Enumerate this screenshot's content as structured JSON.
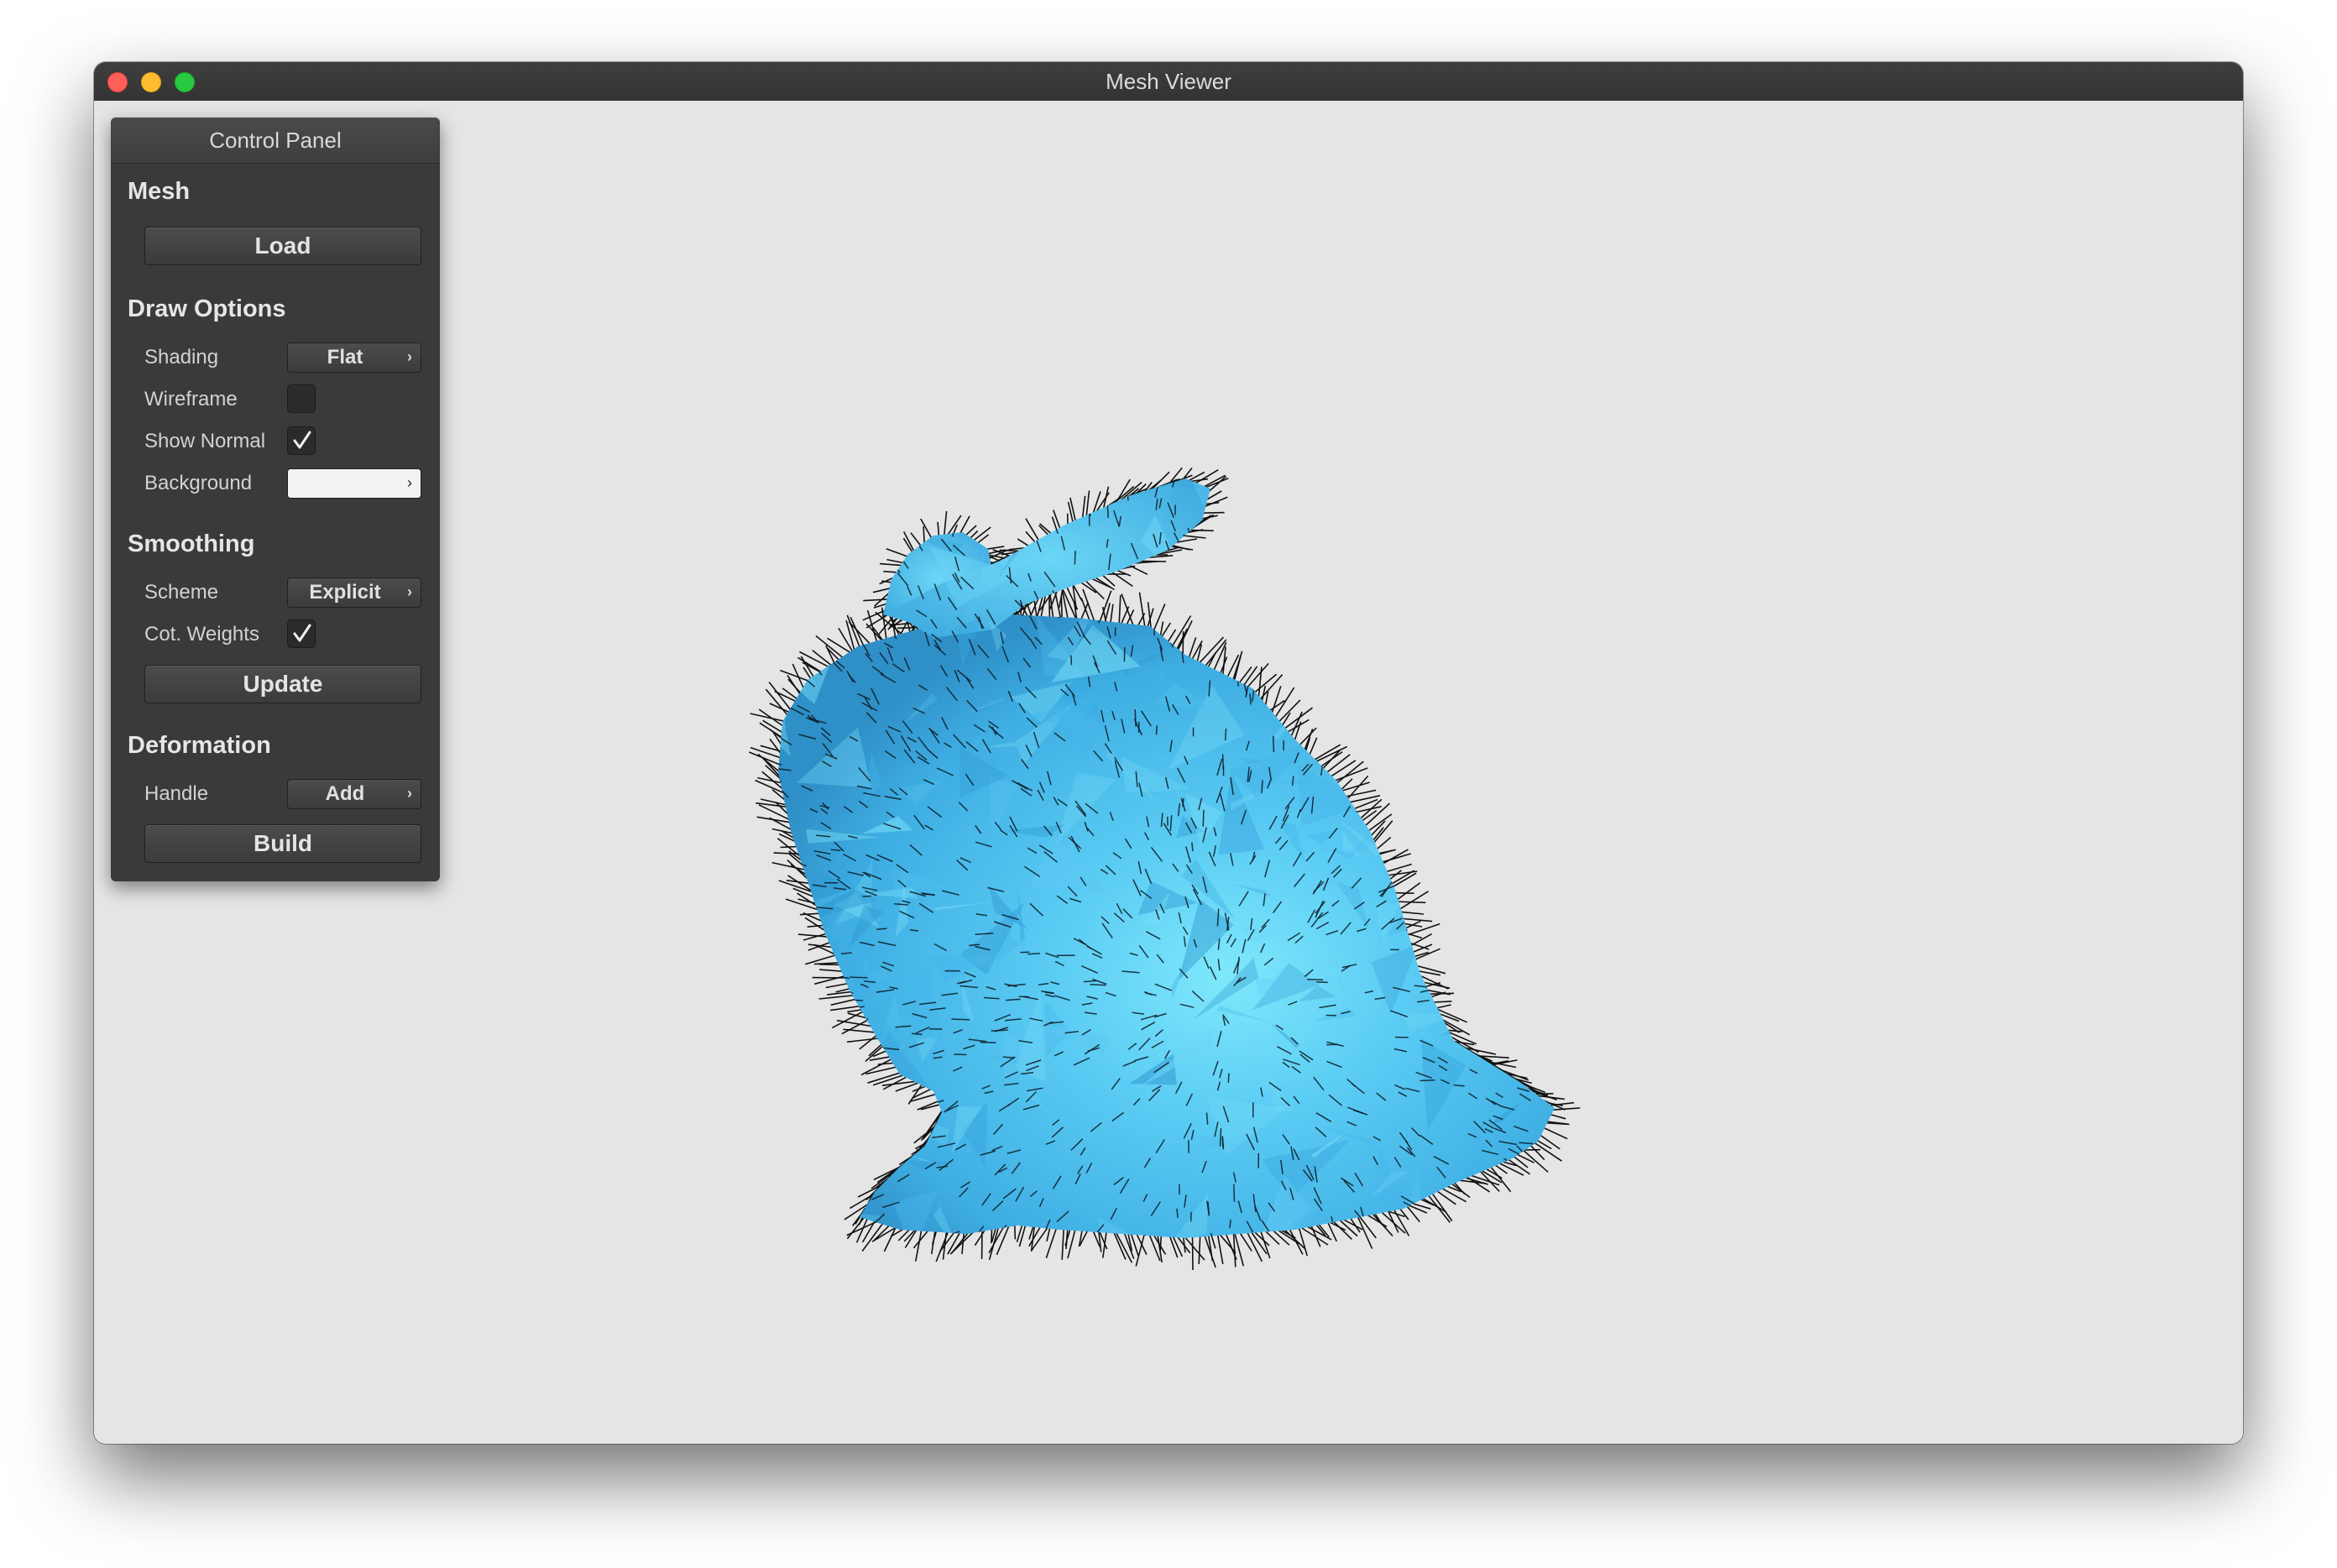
{
  "window": {
    "title": "Mesh Viewer"
  },
  "panel": {
    "title": "Control Panel",
    "mesh": {
      "heading": "Mesh",
      "load_label": "Load"
    },
    "draw_options": {
      "heading": "Draw Options",
      "shading_label": "Shading",
      "shading_value": "Flat",
      "wireframe_label": "Wireframe",
      "wireframe_checked": false,
      "show_normal_label": "Show Normal",
      "show_normal_checked": true,
      "background_label": "Background",
      "background_color": "#f3f3f3"
    },
    "smoothing": {
      "heading": "Smoothing",
      "scheme_label": "Scheme",
      "scheme_value": "Explicit",
      "cot_weights_label": "Cot. Weights",
      "cot_weights_checked": true,
      "update_label": "Update"
    },
    "deformation": {
      "heading": "Deformation",
      "handle_label": "Handle",
      "handle_value": "Add",
      "build_label": "Build"
    }
  },
  "viewport": {
    "mesh_color": "#4ec0ef",
    "normal_color": "#111111",
    "background_color": "#e5e5e5"
  },
  "icons": {
    "combo_chevron": "chevron-right-icon",
    "checkmark": "checkmark-icon"
  }
}
